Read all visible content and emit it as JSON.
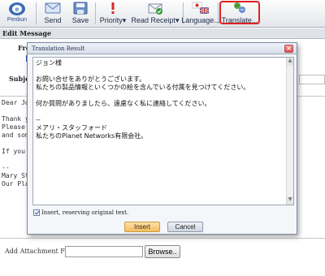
{
  "toolbar": {
    "brand": "Penbun",
    "send_label": "Send",
    "save_label": "Save",
    "priority_label": "Priority",
    "read_receipt_label": "Read Receipt",
    "language_label": "Language...",
    "translate_label": "Translate...",
    "highlight_color": "#e02020"
  },
  "section": {
    "title": "Edit Message"
  },
  "background": {
    "from_label": "Fro",
    "subject_label": "Subjec",
    "body_lines": [
      "Dear Jo",
      "",
      "Thank y",
      "Please ",
      "and som",
      "",
      "If you ",
      "",
      "--",
      "Mary St",
      "Our Pla"
    ],
    "attach_label": "Add Attachment File :",
    "browse_label": "Browse.."
  },
  "dialog": {
    "title": "Translation Result",
    "close_glyph": "×",
    "text_lines": [
      "ジョン様",
      "",
      "お問い合せをありがとうございます。",
      "私たちの製品情報といくつかの絵を含んでいる付属を見つけてください。",
      "",
      "何か質問がありましたら、遠慮なく私に連絡してください。",
      "",
      "--",
      "メアリ・スタッフォード",
      "私たちのPlanet Networks有限会社。"
    ],
    "checkbox_label": "Insert, reserving original text.",
    "checkbox_checked": true,
    "insert_label": "Insert",
    "cancel_label": "Cancel"
  }
}
